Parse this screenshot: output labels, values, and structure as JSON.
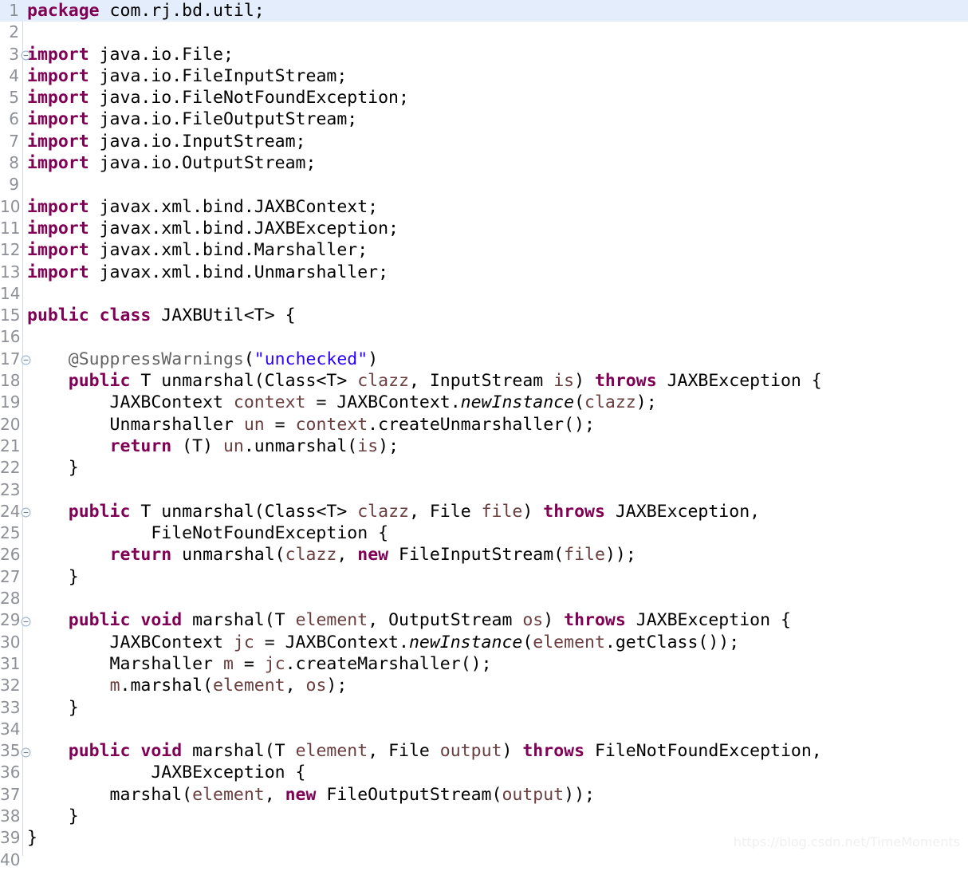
{
  "editor": {
    "language": "java",
    "current_line": 1,
    "total_lines": 40,
    "colors": {
      "background": "#ffffff",
      "current_line_highlight": "#e4edfb",
      "gutter_text": "#8d9096",
      "gutter_rule": "#d5d8dc",
      "keyword": "#7f0055",
      "string": "#2a00ff",
      "annotation": "#646464",
      "variable": "#6a3e3e",
      "plain": "#000000",
      "watermark": "#f0f0f0"
    }
  },
  "watermark": {
    "text": "https://blog.csdn.net/TimeMoments"
  },
  "lines": [
    {
      "n": 1,
      "fold": false,
      "current": true,
      "tokens": [
        {
          "t": "package",
          "c": "kw"
        },
        {
          "t": " com.rj.bd.util;",
          "c": "pln"
        }
      ]
    },
    {
      "n": 2,
      "fold": false,
      "tokens": []
    },
    {
      "n": 3,
      "fold": true,
      "tokens": [
        {
          "t": "import",
          "c": "kw"
        },
        {
          "t": " java.io.File;",
          "c": "pln"
        }
      ]
    },
    {
      "n": 4,
      "fold": false,
      "tokens": [
        {
          "t": "import",
          "c": "kw"
        },
        {
          "t": " java.io.FileInputStream;",
          "c": "pln"
        }
      ]
    },
    {
      "n": 5,
      "fold": false,
      "tokens": [
        {
          "t": "import",
          "c": "kw"
        },
        {
          "t": " java.io.FileNotFoundException;",
          "c": "pln"
        }
      ]
    },
    {
      "n": 6,
      "fold": false,
      "tokens": [
        {
          "t": "import",
          "c": "kw"
        },
        {
          "t": " java.io.FileOutputStream;",
          "c": "pln"
        }
      ]
    },
    {
      "n": 7,
      "fold": false,
      "tokens": [
        {
          "t": "import",
          "c": "kw"
        },
        {
          "t": " java.io.InputStream;",
          "c": "pln"
        }
      ]
    },
    {
      "n": 8,
      "fold": false,
      "tokens": [
        {
          "t": "import",
          "c": "kw"
        },
        {
          "t": " java.io.OutputStream;",
          "c": "pln"
        }
      ]
    },
    {
      "n": 9,
      "fold": false,
      "tokens": []
    },
    {
      "n": 10,
      "fold": false,
      "tokens": [
        {
          "t": "import",
          "c": "kw"
        },
        {
          "t": " javax.xml.bind.JAXBContext;",
          "c": "pln"
        }
      ]
    },
    {
      "n": 11,
      "fold": false,
      "tokens": [
        {
          "t": "import",
          "c": "kw"
        },
        {
          "t": " javax.xml.bind.JAXBException;",
          "c": "pln"
        }
      ]
    },
    {
      "n": 12,
      "fold": false,
      "tokens": [
        {
          "t": "import",
          "c": "kw"
        },
        {
          "t": " javax.xml.bind.Marshaller;",
          "c": "pln"
        }
      ]
    },
    {
      "n": 13,
      "fold": false,
      "tokens": [
        {
          "t": "import",
          "c": "kw"
        },
        {
          "t": " javax.xml.bind.Unmarshaller;",
          "c": "pln"
        }
      ]
    },
    {
      "n": 14,
      "fold": false,
      "tokens": []
    },
    {
      "n": 15,
      "fold": false,
      "tokens": [
        {
          "t": "public",
          "c": "kw"
        },
        {
          "t": " ",
          "c": "pln"
        },
        {
          "t": "class",
          "c": "kw"
        },
        {
          "t": " JAXBUtil<T> {",
          "c": "pln"
        }
      ]
    },
    {
      "n": 16,
      "fold": false,
      "tokens": []
    },
    {
      "n": 17,
      "fold": true,
      "tokens": [
        {
          "t": "    ",
          "c": "pln"
        },
        {
          "t": "@SuppressWarnings",
          "c": "ann"
        },
        {
          "t": "(",
          "c": "pln"
        },
        {
          "t": "\"unchecked\"",
          "c": "str"
        },
        {
          "t": ")",
          "c": "pln"
        }
      ]
    },
    {
      "n": 18,
      "fold": false,
      "tokens": [
        {
          "t": "    ",
          "c": "pln"
        },
        {
          "t": "public",
          "c": "kw"
        },
        {
          "t": " T unmarshal(Class<T> ",
          "c": "pln"
        },
        {
          "t": "clazz",
          "c": "var"
        },
        {
          "t": ", InputStream ",
          "c": "pln"
        },
        {
          "t": "is",
          "c": "var"
        },
        {
          "t": ") ",
          "c": "pln"
        },
        {
          "t": "throws",
          "c": "kw"
        },
        {
          "t": " JAXBException {",
          "c": "pln"
        }
      ]
    },
    {
      "n": 19,
      "fold": false,
      "tokens": [
        {
          "t": "        JAXBContext ",
          "c": "pln"
        },
        {
          "t": "context",
          "c": "var"
        },
        {
          "t": " = JAXBContext.",
          "c": "pln"
        },
        {
          "t": "newInstance",
          "c": "stm"
        },
        {
          "t": "(",
          "c": "pln"
        },
        {
          "t": "clazz",
          "c": "var"
        },
        {
          "t": ");",
          "c": "pln"
        }
      ]
    },
    {
      "n": 20,
      "fold": false,
      "tokens": [
        {
          "t": "        Unmarshaller ",
          "c": "pln"
        },
        {
          "t": "un",
          "c": "var"
        },
        {
          "t": " = ",
          "c": "pln"
        },
        {
          "t": "context",
          "c": "var"
        },
        {
          "t": ".createUnmarshaller();",
          "c": "pln"
        }
      ]
    },
    {
      "n": 21,
      "fold": false,
      "tokens": [
        {
          "t": "        ",
          "c": "pln"
        },
        {
          "t": "return",
          "c": "kw"
        },
        {
          "t": " (T) ",
          "c": "pln"
        },
        {
          "t": "un",
          "c": "var"
        },
        {
          "t": ".unmarshal(",
          "c": "pln"
        },
        {
          "t": "is",
          "c": "var"
        },
        {
          "t": ");",
          "c": "pln"
        }
      ]
    },
    {
      "n": 22,
      "fold": false,
      "tokens": [
        {
          "t": "    }",
          "c": "pln"
        }
      ]
    },
    {
      "n": 23,
      "fold": false,
      "tokens": []
    },
    {
      "n": 24,
      "fold": true,
      "tokens": [
        {
          "t": "    ",
          "c": "pln"
        },
        {
          "t": "public",
          "c": "kw"
        },
        {
          "t": " T unmarshal(Class<T> ",
          "c": "pln"
        },
        {
          "t": "clazz",
          "c": "var"
        },
        {
          "t": ", File ",
          "c": "pln"
        },
        {
          "t": "file",
          "c": "var"
        },
        {
          "t": ") ",
          "c": "pln"
        },
        {
          "t": "throws",
          "c": "kw"
        },
        {
          "t": " JAXBException,",
          "c": "pln"
        }
      ]
    },
    {
      "n": 25,
      "fold": false,
      "tokens": [
        {
          "t": "            FileNotFoundException {",
          "c": "pln"
        }
      ]
    },
    {
      "n": 26,
      "fold": false,
      "tokens": [
        {
          "t": "        ",
          "c": "pln"
        },
        {
          "t": "return",
          "c": "kw"
        },
        {
          "t": " unmarshal(",
          "c": "pln"
        },
        {
          "t": "clazz",
          "c": "var"
        },
        {
          "t": ", ",
          "c": "pln"
        },
        {
          "t": "new",
          "c": "kw"
        },
        {
          "t": " FileInputStream(",
          "c": "pln"
        },
        {
          "t": "file",
          "c": "var"
        },
        {
          "t": "));",
          "c": "pln"
        }
      ]
    },
    {
      "n": 27,
      "fold": false,
      "tokens": [
        {
          "t": "    }",
          "c": "pln"
        }
      ]
    },
    {
      "n": 28,
      "fold": false,
      "tokens": []
    },
    {
      "n": 29,
      "fold": true,
      "tokens": [
        {
          "t": "    ",
          "c": "pln"
        },
        {
          "t": "public",
          "c": "kw"
        },
        {
          "t": " ",
          "c": "pln"
        },
        {
          "t": "void",
          "c": "kw"
        },
        {
          "t": " marshal(T ",
          "c": "pln"
        },
        {
          "t": "element",
          "c": "var"
        },
        {
          "t": ", OutputStream ",
          "c": "pln"
        },
        {
          "t": "os",
          "c": "var"
        },
        {
          "t": ") ",
          "c": "pln"
        },
        {
          "t": "throws",
          "c": "kw"
        },
        {
          "t": " JAXBException {",
          "c": "pln"
        }
      ]
    },
    {
      "n": 30,
      "fold": false,
      "tokens": [
        {
          "t": "        JAXBContext ",
          "c": "pln"
        },
        {
          "t": "jc",
          "c": "var"
        },
        {
          "t": " = JAXBContext.",
          "c": "pln"
        },
        {
          "t": "newInstance",
          "c": "stm"
        },
        {
          "t": "(",
          "c": "pln"
        },
        {
          "t": "element",
          "c": "var"
        },
        {
          "t": ".getClass());",
          "c": "pln"
        }
      ]
    },
    {
      "n": 31,
      "fold": false,
      "tokens": [
        {
          "t": "        Marshaller ",
          "c": "pln"
        },
        {
          "t": "m",
          "c": "var"
        },
        {
          "t": " = ",
          "c": "pln"
        },
        {
          "t": "jc",
          "c": "var"
        },
        {
          "t": ".createMarshaller();",
          "c": "pln"
        }
      ]
    },
    {
      "n": 32,
      "fold": false,
      "tokens": [
        {
          "t": "        ",
          "c": "pln"
        },
        {
          "t": "m",
          "c": "var"
        },
        {
          "t": ".marshal(",
          "c": "pln"
        },
        {
          "t": "element",
          "c": "var"
        },
        {
          "t": ", ",
          "c": "pln"
        },
        {
          "t": "os",
          "c": "var"
        },
        {
          "t": ");",
          "c": "pln"
        }
      ]
    },
    {
      "n": 33,
      "fold": false,
      "tokens": [
        {
          "t": "    }",
          "c": "pln"
        }
      ]
    },
    {
      "n": 34,
      "fold": false,
      "tokens": []
    },
    {
      "n": 35,
      "fold": true,
      "tokens": [
        {
          "t": "    ",
          "c": "pln"
        },
        {
          "t": "public",
          "c": "kw"
        },
        {
          "t": " ",
          "c": "pln"
        },
        {
          "t": "void",
          "c": "kw"
        },
        {
          "t": " marshal(T ",
          "c": "pln"
        },
        {
          "t": "element",
          "c": "var"
        },
        {
          "t": ", File ",
          "c": "pln"
        },
        {
          "t": "output",
          "c": "var"
        },
        {
          "t": ") ",
          "c": "pln"
        },
        {
          "t": "throws",
          "c": "kw"
        },
        {
          "t": " FileNotFoundException,",
          "c": "pln"
        }
      ]
    },
    {
      "n": 36,
      "fold": false,
      "tokens": [
        {
          "t": "            JAXBException {",
          "c": "pln"
        }
      ]
    },
    {
      "n": 37,
      "fold": false,
      "tokens": [
        {
          "t": "        marshal(",
          "c": "pln"
        },
        {
          "t": "element",
          "c": "var"
        },
        {
          "t": ", ",
          "c": "pln"
        },
        {
          "t": "new",
          "c": "kw"
        },
        {
          "t": " FileOutputStream(",
          "c": "pln"
        },
        {
          "t": "output",
          "c": "var"
        },
        {
          "t": "));",
          "c": "pln"
        }
      ]
    },
    {
      "n": 38,
      "fold": false,
      "tokens": [
        {
          "t": "    }",
          "c": "pln"
        }
      ]
    },
    {
      "n": 39,
      "fold": false,
      "tokens": [
        {
          "t": "}",
          "c": "pln"
        }
      ]
    },
    {
      "n": 40,
      "fold": false,
      "tokens": []
    }
  ]
}
